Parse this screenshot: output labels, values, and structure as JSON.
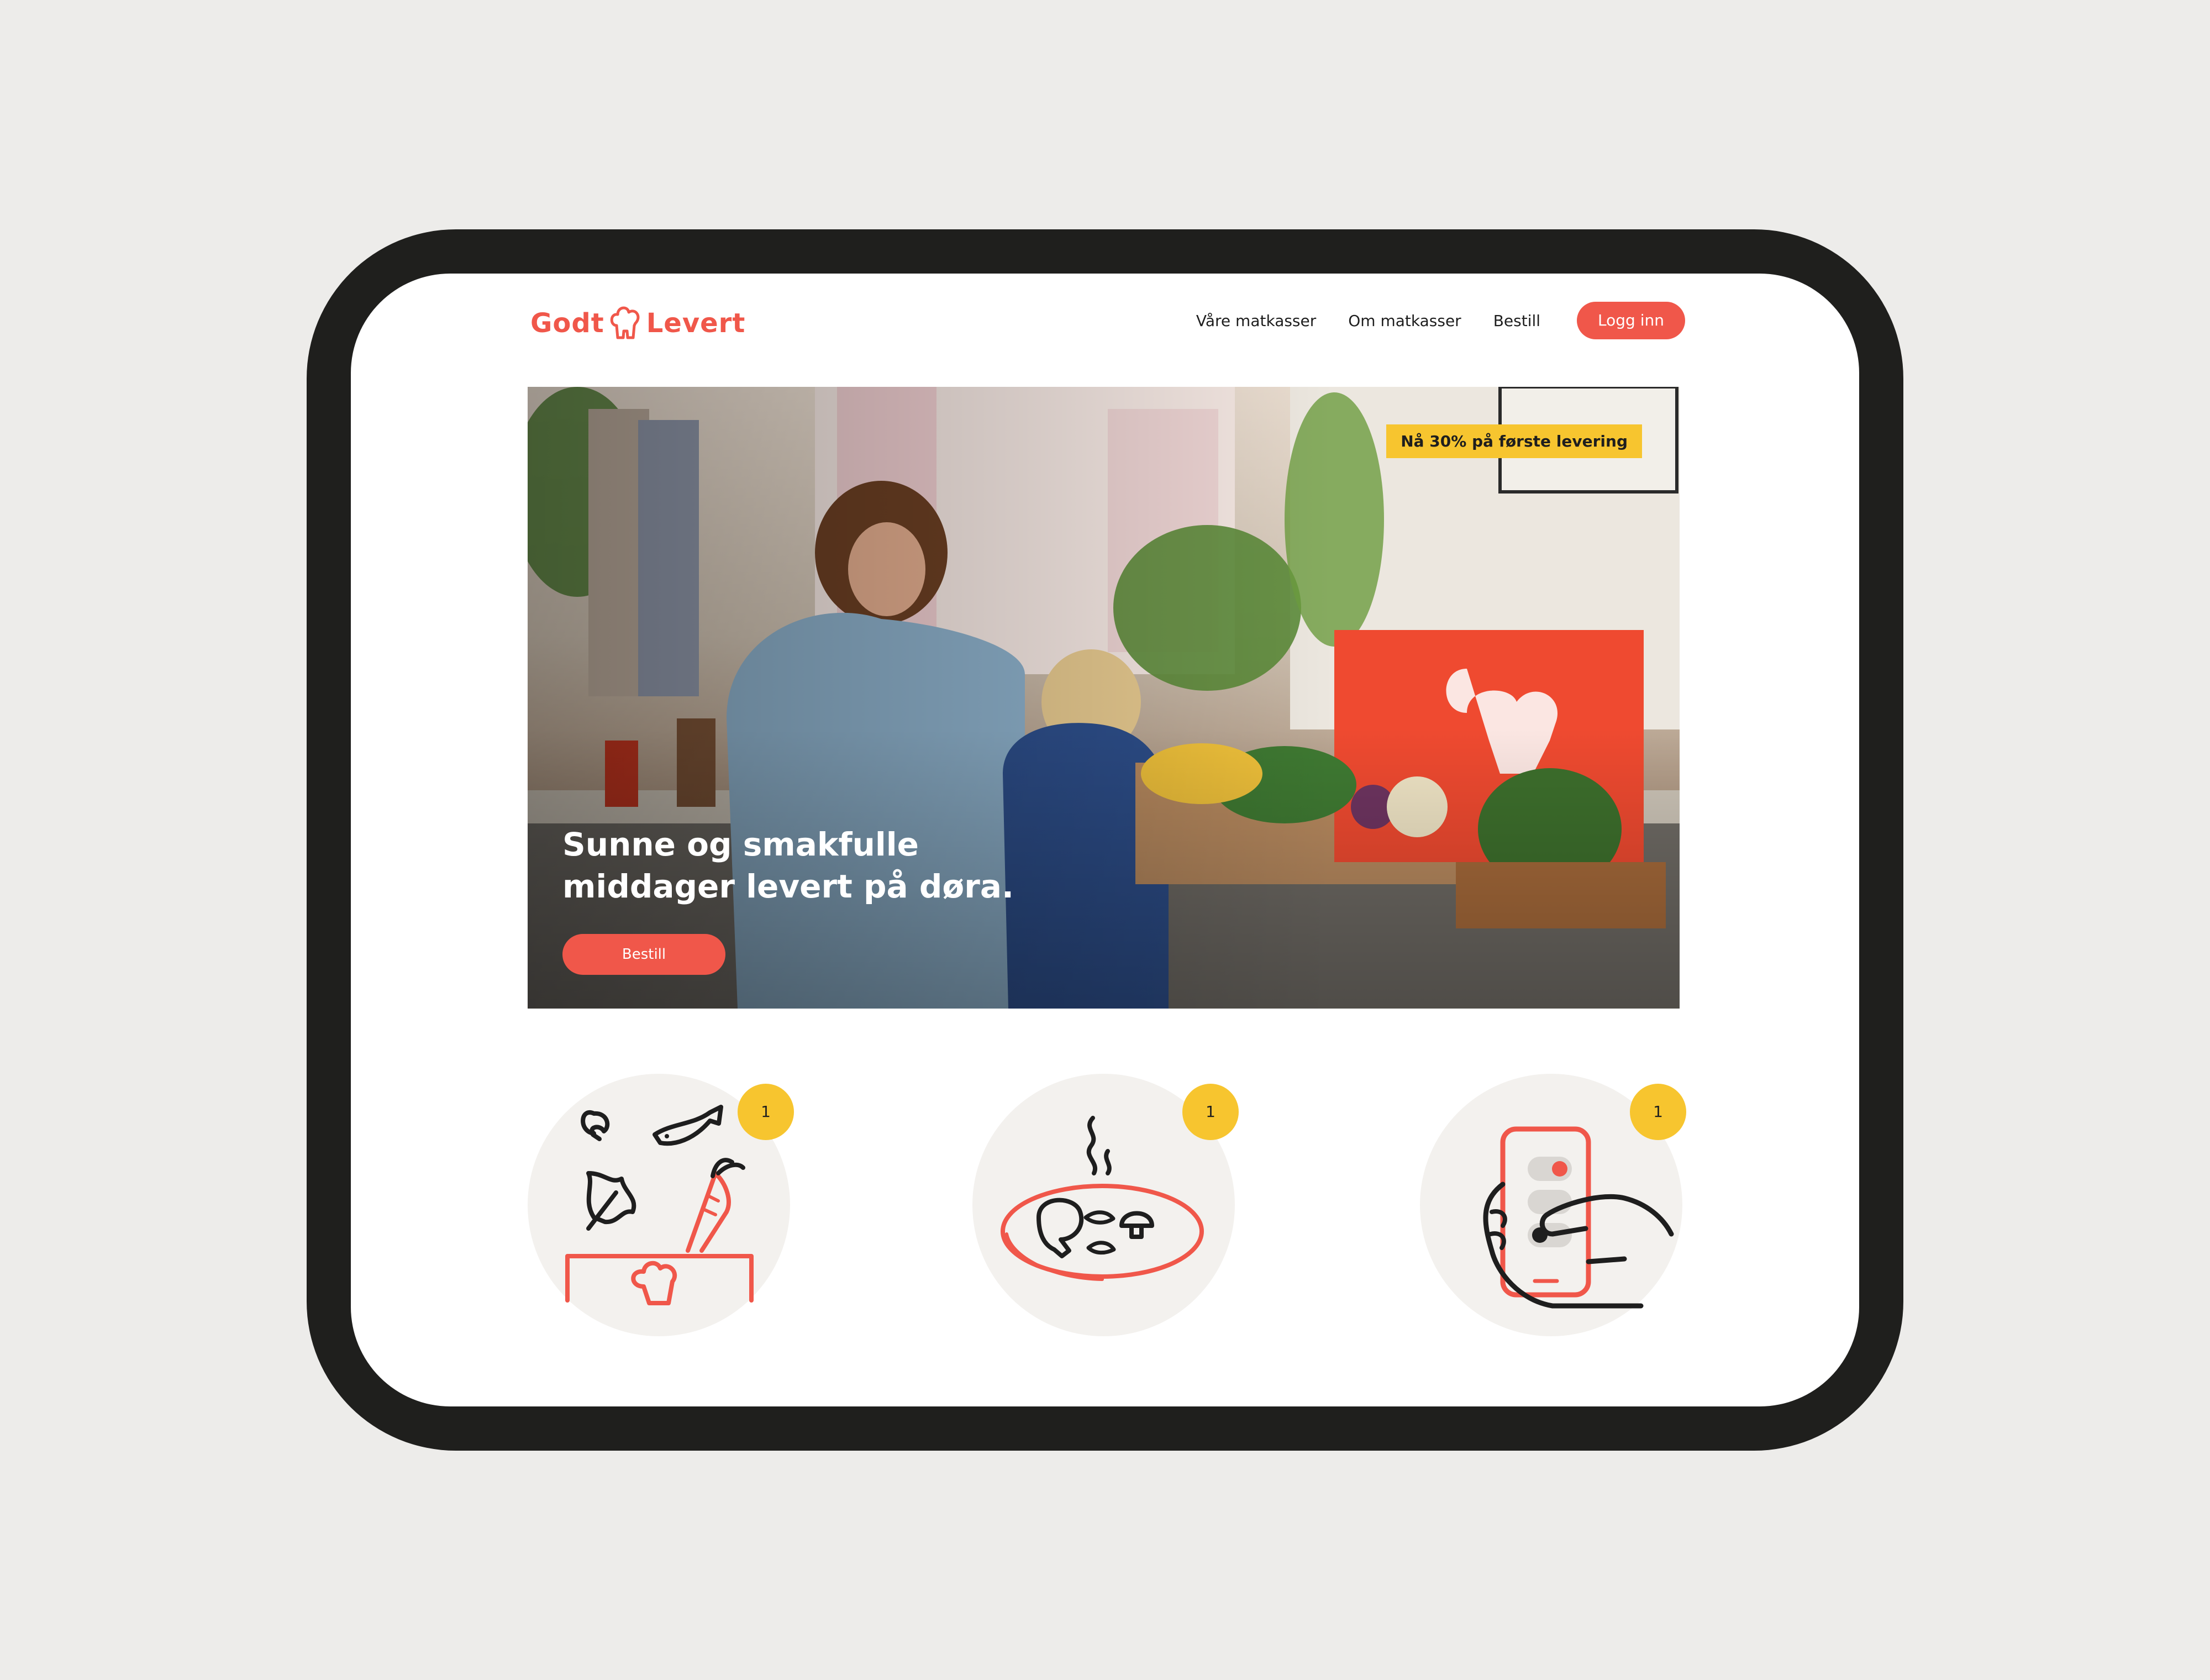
{
  "brand": {
    "name_part1": "Godt",
    "name_part2": "Levert",
    "accent_color": "#f0574a",
    "highlight_color": "#f7c52f"
  },
  "nav": {
    "items": [
      "Våre matkasser",
      "Om matkasser",
      "Bestill"
    ],
    "login_label": "Logg inn"
  },
  "hero": {
    "promo": "Nå 30% på første levering",
    "headline_line1": "Sunne og smakfulle",
    "headline_line2": "middager levert på døra.",
    "cta_label": "Bestill",
    "image": "kitchen-family-photo"
  },
  "steps": [
    {
      "badge": "1",
      "icon": "ingredients-box-icon"
    },
    {
      "badge": "1",
      "icon": "hot-dinner-plate-icon"
    },
    {
      "badge": "1",
      "icon": "phone-order-icon"
    }
  ]
}
